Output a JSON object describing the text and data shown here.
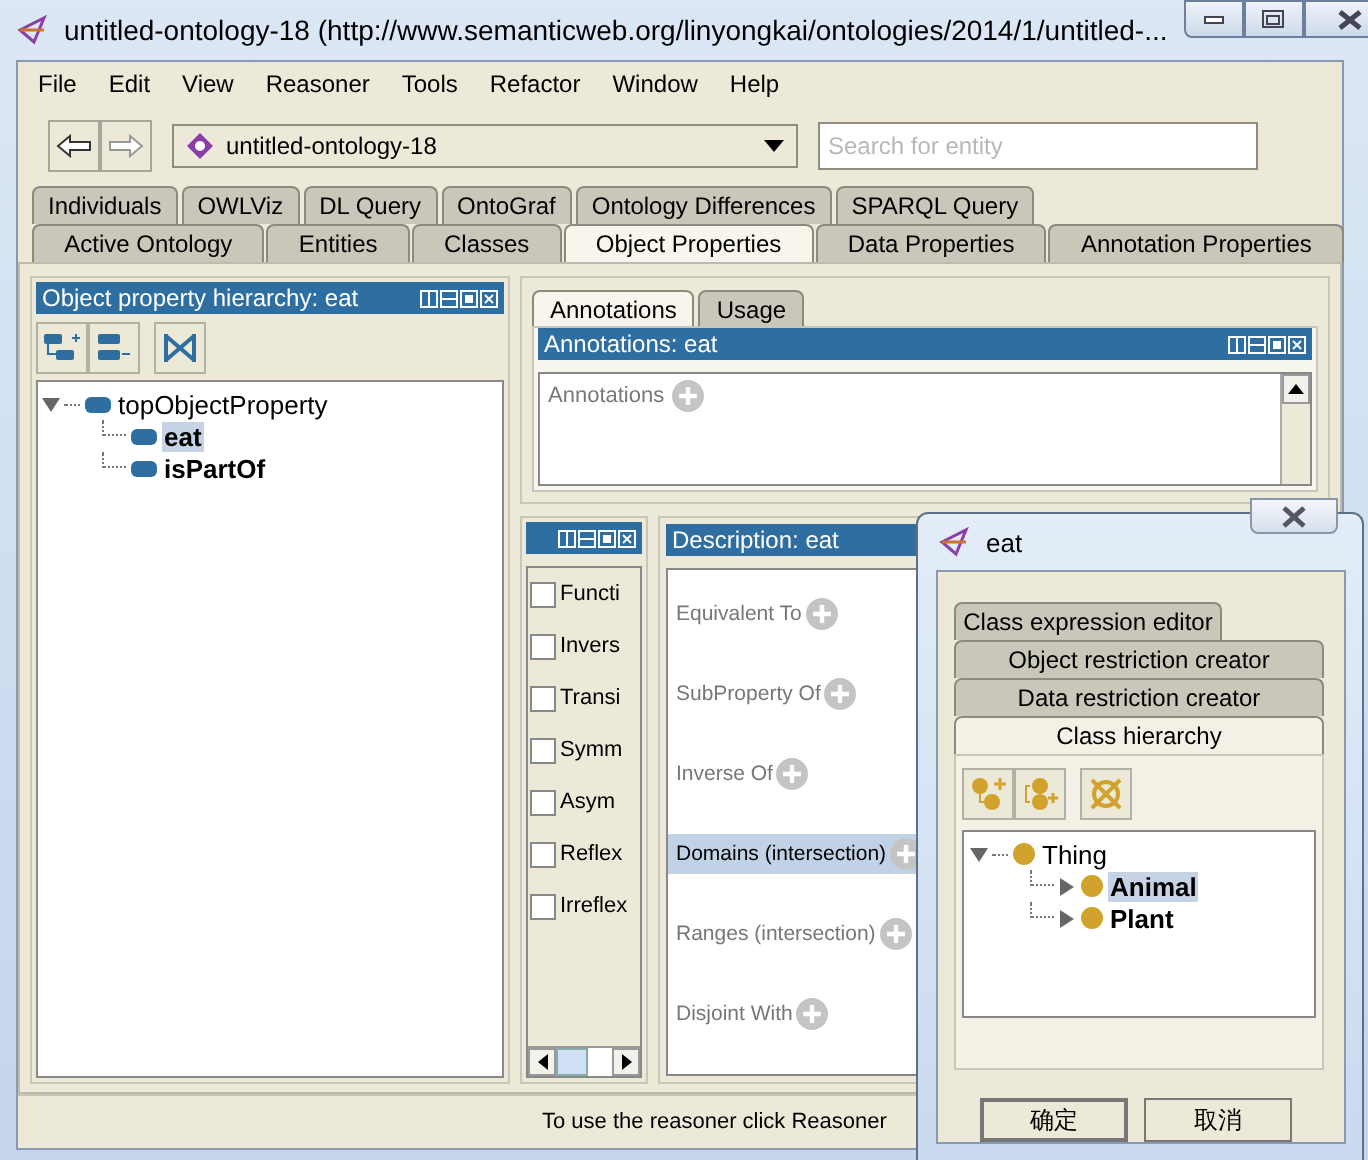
{
  "window": {
    "title": "untitled-ontology-18 (http://www.semanticweb.org/linyongkai/ontologies/2014/1/untitled-..."
  },
  "menu": [
    "File",
    "Edit",
    "View",
    "Reasoner",
    "Tools",
    "Refactor",
    "Window",
    "Help"
  ],
  "toolbar": {
    "ontology": "untitled-ontology-18",
    "search": {
      "placeholder": "Search for entity"
    }
  },
  "tabs_row_1": [
    {
      "label": "Individuals",
      "selected": false
    },
    {
      "label": "OWLViz",
      "selected": false
    },
    {
      "label": "DL Query",
      "selected": false
    },
    {
      "label": "OntoGraf",
      "selected": false
    },
    {
      "label": "Ontology Differences",
      "selected": false
    },
    {
      "label": "SPARQL Query",
      "selected": false
    }
  ],
  "tabs_row_2": [
    {
      "label": "Active Ontology",
      "selected": false
    },
    {
      "label": "Entities",
      "selected": false
    },
    {
      "label": "Classes",
      "selected": false
    },
    {
      "label": "Object Properties",
      "selected": true
    },
    {
      "label": "Data Properties",
      "selected": false
    },
    {
      "label": "Annotation Properties",
      "selected": false
    }
  ],
  "hierarchy_panel": {
    "title": "Object property hierarchy: eat",
    "tree": [
      {
        "label": "topObjectProperty",
        "expanded": true,
        "selected": false,
        "children": [
          {
            "label": "eat",
            "selected": true
          },
          {
            "label": "isPartOf",
            "selected": false
          }
        ]
      }
    ]
  },
  "annotation_tabs": [
    {
      "label": "Annotations",
      "selected": true
    },
    {
      "label": "Usage",
      "selected": false
    }
  ],
  "annotations_panel": {
    "title": "Annotations: eat",
    "section": "Annotations"
  },
  "characteristics": [
    {
      "label": "Functi",
      "checked": false
    },
    {
      "label": "Invers",
      "checked": false
    },
    {
      "label": "Transi",
      "checked": false
    },
    {
      "label": "Symm",
      "checked": false
    },
    {
      "label": "Asym",
      "checked": false
    },
    {
      "label": "Reflex",
      "checked": false
    },
    {
      "label": "Irreflex",
      "checked": false
    }
  ],
  "description_panel": {
    "title": "Description: eat",
    "sections": [
      {
        "label": "Equivalent To",
        "selected": false
      },
      {
        "label": "SubProperty Of",
        "selected": false
      },
      {
        "label": "Inverse Of",
        "selected": false
      },
      {
        "label": "Domains (intersection)",
        "selected": true
      },
      {
        "label": "Ranges (intersection)",
        "selected": false
      },
      {
        "label": "Disjoint With",
        "selected": false
      }
    ]
  },
  "status_bar": "To use the reasoner click Reasoner",
  "dialog": {
    "title": "eat",
    "tabs": [
      {
        "label": "Class expression editor",
        "selected": false
      },
      {
        "label": "Object restriction creator",
        "selected": false
      },
      {
        "label": "Data restriction creator",
        "selected": false
      },
      {
        "label": "Class hierarchy",
        "selected": true
      }
    ],
    "tree": [
      {
        "label": "Thing",
        "expanded": true,
        "selected": false,
        "children": [
          {
            "label": "Animal",
            "expanded": false,
            "selected": true
          },
          {
            "label": "Plant",
            "expanded": false,
            "selected": false
          }
        ]
      }
    ],
    "buttons": [
      "确定",
      "取消"
    ]
  }
}
